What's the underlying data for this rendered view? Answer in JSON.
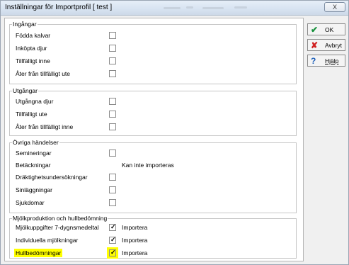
{
  "window": {
    "title": "Inställningar för Importprofil [ test ]",
    "close_label": "X"
  },
  "buttons": {
    "ok": "OK",
    "cancel": "Avbryt",
    "help": "Hjälp"
  },
  "groups": [
    {
      "legend": "Ingångar",
      "rows": [
        {
          "label": "Födda kalvar",
          "checked": false,
          "value": ""
        },
        {
          "label": "Inköpta djur",
          "checked": false,
          "value": ""
        },
        {
          "label": "Tillfälligt inne",
          "checked": false,
          "value": ""
        },
        {
          "label": "Åter från tillfälligt ute",
          "checked": false,
          "value": ""
        }
      ]
    },
    {
      "legend": "Utgångar",
      "rows": [
        {
          "label": "Utgångna djur",
          "checked": false,
          "value": ""
        },
        {
          "label": "Tillfälligt ute",
          "checked": false,
          "value": ""
        },
        {
          "label": "Åter från tillfälligt inne",
          "checked": false,
          "value": ""
        }
      ]
    },
    {
      "legend": "Övriga händelser",
      "rows": [
        {
          "label": "Semineringar",
          "checked": false,
          "value": ""
        },
        {
          "label": "Betäckningar",
          "checked": null,
          "value": "Kan inte importeras"
        },
        {
          "label": "Dräktighetsundersökningar",
          "checked": false,
          "value": ""
        },
        {
          "label": "Sinläggningar",
          "checked": false,
          "value": ""
        },
        {
          "label": "Sjukdomar",
          "checked": false,
          "value": ""
        }
      ]
    },
    {
      "legend": "Mjölkproduktion och hullbedömning",
      "rows": [
        {
          "label": "Mjölkuppgifter 7-dygnsmedeltal",
          "checked": true,
          "value": "Importera"
        },
        {
          "label": "Individuella mjölkningar",
          "checked": true,
          "value": "Importera"
        },
        {
          "label": "Hullbedömningar",
          "checked": true,
          "value": "Importera",
          "highlighted": true
        }
      ]
    }
  ],
  "colors": {
    "highlight": "#ffff00",
    "ok_icon": "#15903a",
    "cancel_icon": "#d02020",
    "help_icon": "#1d5fb8"
  }
}
